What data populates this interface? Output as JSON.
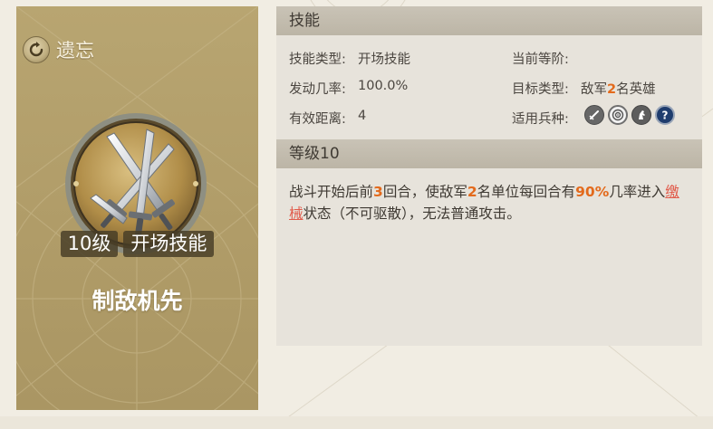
{
  "left_card": {
    "forget_label": "遗忘",
    "level_badge": "10级",
    "type_badge": "开场技能",
    "skill_name": "制敌机先"
  },
  "skill_section": {
    "header": "技能",
    "skill_type_label": "技能类型:",
    "skill_type_value": "开场技能",
    "rank_label": "当前等阶:",
    "rank_value": "",
    "trigger_rate_label": "发动几率:",
    "trigger_rate_value": "100.0%",
    "target_type_label": "目标类型:",
    "target_prefix": "敌军",
    "target_count": "2",
    "target_suffix": "名英雄",
    "range_label": "有效距离:",
    "range_value": "4",
    "troop_label": "适用兵种:",
    "troop_icons": [
      "sword-troop-icon",
      "archer-target-icon",
      "cavalry-horse-icon",
      "unknown-question-icon"
    ]
  },
  "level_section": {
    "header": "等级10",
    "desc_part1": "战斗开始后前",
    "desc_rounds": "3",
    "desc_part2": "回合，使敌军",
    "desc_count": "2",
    "desc_part3": "名单位每回合有",
    "desc_rate": "90%",
    "desc_part4": "几率进入",
    "desc_status": "缴械",
    "desc_part5": "状态（不可驱散），无法普通攻击。"
  },
  "colors": {
    "highlight": "#e36a1c",
    "status_link": "#e15a4a",
    "card_gold": "#b09c68",
    "panel_bg": "#e7e3db",
    "header_bg": "#c2bcae"
  }
}
